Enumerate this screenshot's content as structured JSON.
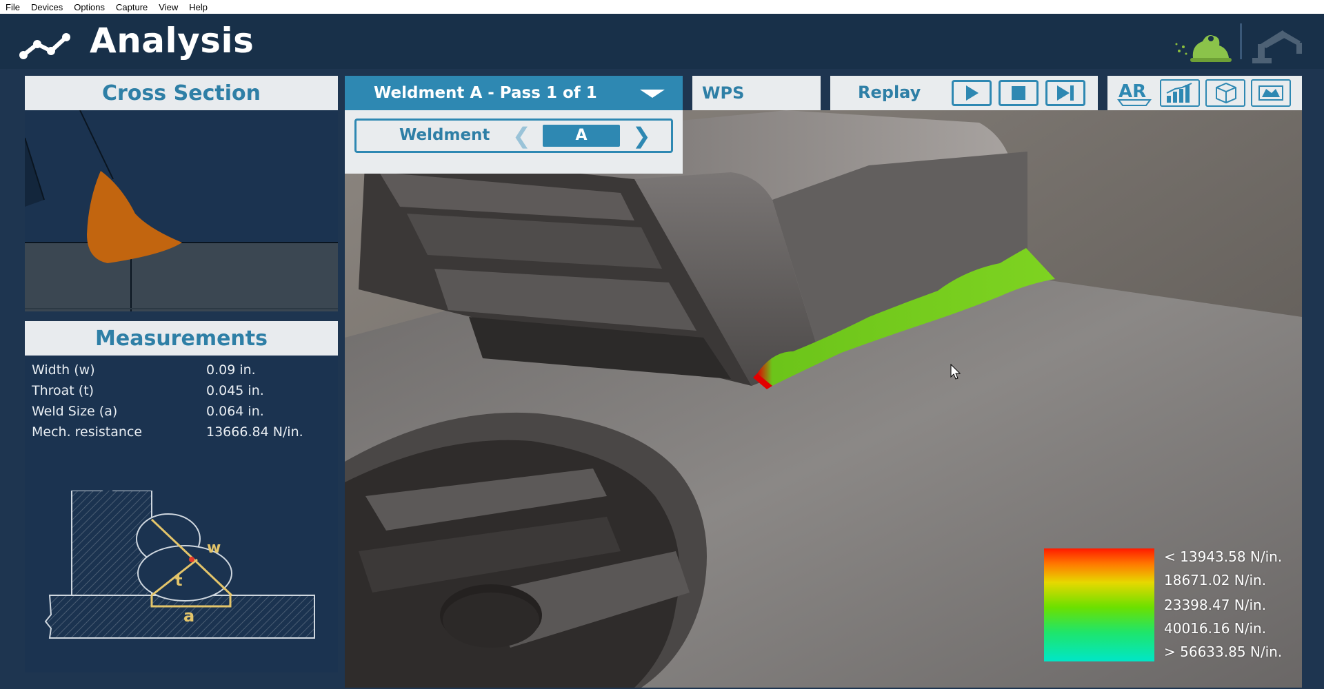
{
  "menu": [
    "File",
    "Devices",
    "Options",
    "Capture",
    "View",
    "Help"
  ],
  "header": {
    "title": "Analysis",
    "logo_icon": "analysis-graph-icon",
    "right_icons": [
      "frog-icon",
      "robot-arm-icon"
    ]
  },
  "cross_section": {
    "title": "Cross Section",
    "weld_color": "#c2650f"
  },
  "measurements": {
    "title": "Measurements",
    "rows": [
      {
        "label": "Width (w)",
        "value": "0.09 in."
      },
      {
        "label": "Throat (t)",
        "value": "0.045 in."
      },
      {
        "label": "Weld Size (a)",
        "value": "0.064 in."
      },
      {
        "label": "Mech. resistance",
        "value": "13666.84 N/in."
      }
    ],
    "diagram_labels": {
      "w": "w",
      "t": "t",
      "a": "a"
    }
  },
  "weldment_dropdown": {
    "label": "Weldment A - Pass 1 of 1"
  },
  "weldment_selector": {
    "label": "Weldment",
    "value": "A"
  },
  "toolbar": {
    "wps_label": "WPS",
    "replay_label": "Replay",
    "replay_buttons": [
      "play-icon",
      "stop-icon",
      "skip-to-end-icon"
    ],
    "view_buttons": [
      "ar-icon",
      "bar-chart-icon",
      "cube-icon",
      "layers-icon"
    ],
    "ar_text": "AR"
  },
  "legend": {
    "labels": [
      "< 13943.58 N/in.",
      "18671.02 N/in.",
      "23398.47 N/in.",
      "40016.16 N/in.",
      "> 56633.85 N/in."
    ],
    "colors": [
      "#ff1a00",
      "#e7d800",
      "#6ce000",
      "#00e6c8"
    ]
  },
  "accent_color": "#2e88b2"
}
